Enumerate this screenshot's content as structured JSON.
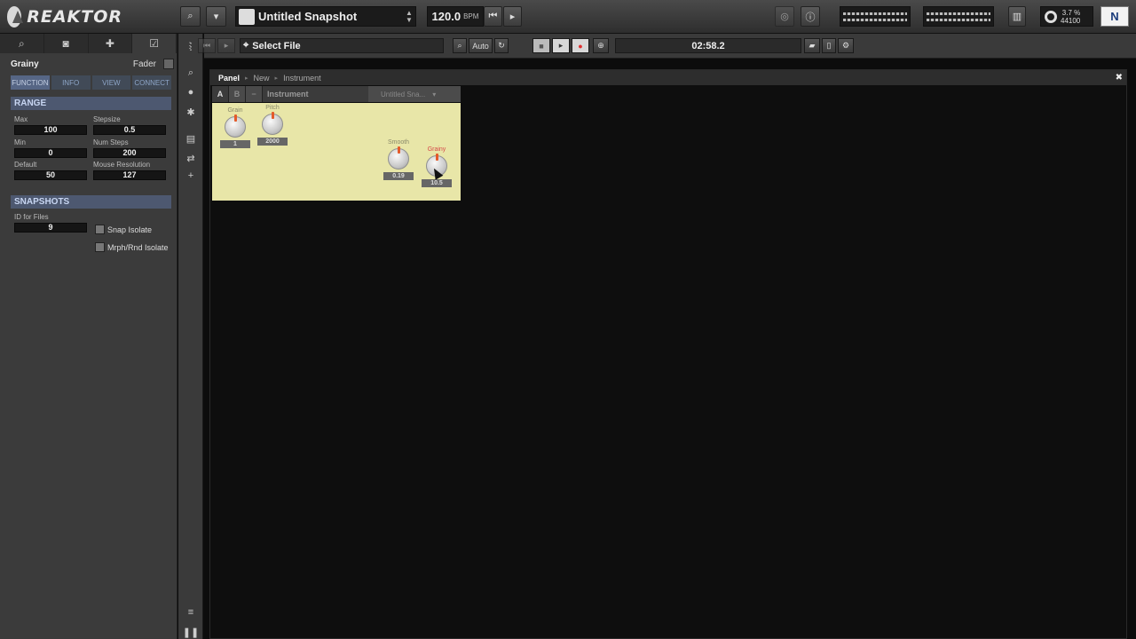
{
  "app": {
    "logo_text": "REAKTOR"
  },
  "topbar": {
    "snapshot_name": "Untitled Snapshot",
    "bpm_value": "120.0",
    "bpm_unit": "BPM",
    "cpu_percent": "3.7 %",
    "sample_rate": "44100",
    "ni_label": "N"
  },
  "leftpanel": {
    "module_name": "Grainy",
    "module_type": "Fader",
    "tabs": [
      "FUNCTION",
      "INFO",
      "VIEW",
      "CONNECT"
    ],
    "range": {
      "header": "RANGE",
      "max_label": "Max",
      "max_value": "100",
      "stepsize_label": "Stepsize",
      "stepsize_value": "0.5",
      "min_label": "Min",
      "min_value": "0",
      "numsteps_label": "Num Steps",
      "numsteps_value": "200",
      "default_label": "Default",
      "default_value": "50",
      "mouse_label": "Mouse Resolution",
      "mouse_value": "127"
    },
    "snapshots": {
      "header": "SNAPSHOTS",
      "id_label": "ID for Files",
      "id_value": "9",
      "snap_isolate": "Snap Isolate",
      "mrph_isolate": "Mrph/Rnd Isolate"
    }
  },
  "toolbar2": {
    "select_file": "Select File",
    "auto_label": "Auto",
    "time": "02:58.2"
  },
  "panel": {
    "breadcrumb": [
      "Panel",
      "New",
      "Instrument"
    ],
    "ab_a": "A",
    "ab_b": "B",
    "instrument_name": "Instrument",
    "instrument_snapshot": "Untitled Sna...",
    "knobs": [
      {
        "label": "Grain",
        "value": "1"
      },
      {
        "label": "Pitch",
        "value": "2000"
      },
      {
        "label": "Smooth",
        "value": "0.19"
      },
      {
        "label": "Grainy",
        "value": "10.5"
      }
    ]
  },
  "colors": {
    "panel_bg": "#e8e6a8",
    "section_header": "#4d5870",
    "record": "#e03030"
  }
}
